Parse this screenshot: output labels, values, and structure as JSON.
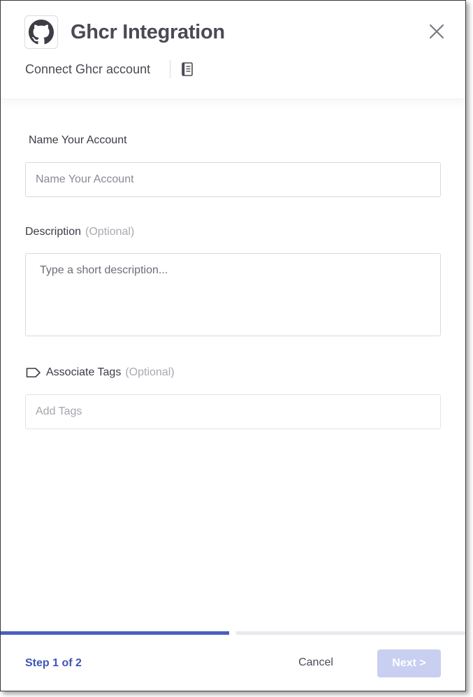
{
  "header": {
    "title": "Ghcr Integration",
    "subtitle": "Connect Ghcr account",
    "logo_icon": "github-icon",
    "close_icon": "close-icon",
    "docs_icon": "document-icon"
  },
  "form": {
    "account_name": {
      "label": "Name Your Account",
      "placeholder": "Name Your Account",
      "value": ""
    },
    "description": {
      "label": "Description",
      "optional": "(Optional)",
      "placeholder": "Type a short description...",
      "value": ""
    },
    "tags": {
      "icon": "tag-icon",
      "label": "Associate Tags",
      "optional": "(Optional)",
      "placeholder": "Add Tags",
      "value": ""
    }
  },
  "footer": {
    "step_text": "Step 1 of 2",
    "progress": 0.5,
    "cancel_label": "Cancel",
    "next_label": "Next >"
  },
  "colors": {
    "accent": "#3f55b5",
    "progress": "#4a5fc1",
    "next_disabled_bg": "#c8cff0",
    "text": "#4a4a55"
  }
}
